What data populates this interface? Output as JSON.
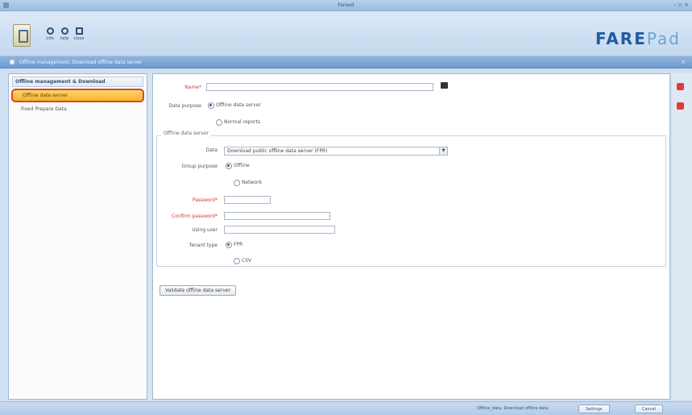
{
  "window": {
    "title": "Fareed"
  },
  "ribbon": {
    "tools": [
      {
        "label": "info",
        "icon": "info-icon"
      },
      {
        "label": "help",
        "icon": "help-icon"
      },
      {
        "label": "close",
        "icon": "close-icon"
      }
    ],
    "brand": {
      "main": "FARE",
      "sub": "Pad"
    }
  },
  "breadcrumb": {
    "text": "Offline management: Download offline data server"
  },
  "sidebar": {
    "header": "Offline management & Download",
    "items": [
      {
        "label": "Offline data server"
      },
      {
        "label": "Fixed Prepare Data"
      }
    ]
  },
  "form": {
    "name_label": "Name*",
    "name_value": "",
    "data_purpose_label": "Data purpose",
    "purpose_options": [
      "Offline data server",
      "Normal reports"
    ],
    "purpose_selected": 0,
    "group_title": "Offline data server",
    "data_label": "Data",
    "data_value": "Download public offline data server (FPR)",
    "group_purpose_label": "Group purpose",
    "group_options": [
      "Offline",
      "Network"
    ],
    "group_selected": 0,
    "password_label": "Password*",
    "password_value": "",
    "confirm_label": "Confirm password*",
    "confirm_value": "",
    "using_user_label": "Using user",
    "using_user_value": "",
    "tenant_type_label": "Tenant type",
    "tenant_options": [
      "FPR",
      "CSV"
    ],
    "tenant_selected": 0,
    "action_button": "Validate offline data server"
  },
  "status": {
    "text": "Offline_data: Download offline data",
    "buttons": [
      "Settings",
      "Cancel"
    ]
  },
  "colors": {
    "active_item_fill": "#f4b42d",
    "active_item_border": "#d8462f",
    "required_label": "#d23a3a",
    "brand": "#1f5c9c"
  }
}
